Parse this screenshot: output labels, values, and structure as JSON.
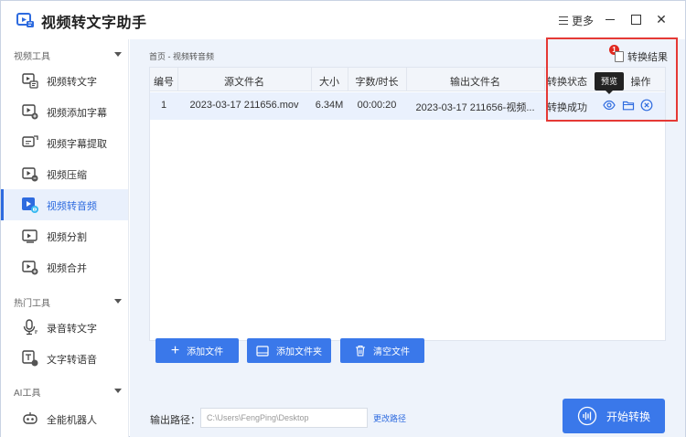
{
  "app": {
    "title": "视频转文字助手",
    "more_label": "更多",
    "brand_color": "#2e6bdf"
  },
  "window_controls": {
    "minimize_icon": "minimize-icon",
    "maximize_icon": "maximize-icon",
    "close_icon": "close-icon",
    "close_glyph": "✕"
  },
  "sidebar": {
    "sections": [
      {
        "label": "视频工具"
      },
      {
        "label": "热门工具"
      },
      {
        "label": "AI工具"
      }
    ],
    "items": [
      {
        "label": "视频转文字",
        "icon": "video-to-text-icon"
      },
      {
        "label": "视频添加字幕",
        "icon": "add-subtitle-icon"
      },
      {
        "label": "视频字幕提取",
        "icon": "extract-subtitle-icon"
      },
      {
        "label": "视频压缩",
        "icon": "compress-icon"
      },
      {
        "label": "视频转音频",
        "icon": "video-to-audio-icon",
        "active": true
      },
      {
        "label": "视频分割",
        "icon": "split-icon"
      },
      {
        "label": "视频合并",
        "icon": "merge-icon"
      },
      {
        "label": "录音转文字",
        "icon": "microphone-icon"
      },
      {
        "label": "文字转语音",
        "icon": "text-to-speech-icon"
      },
      {
        "label": "全能机器人",
        "icon": "robot-icon"
      }
    ]
  },
  "main": {
    "breadcrumb": "首页 - 视频转音频",
    "result_label": "转换结果",
    "result_badge": "1",
    "tooltip": "预览",
    "table": {
      "headers": [
        "编号",
        "源文件名",
        "大小",
        "字数/时长",
        "输出文件名",
        "转换状态",
        "操作"
      ],
      "rows": [
        {
          "index": "1",
          "source": "2023-03-17 211656.mov",
          "size": "6.34M",
          "duration": "00:00:20",
          "output": "2023-03-17 211656-视频...",
          "status": "转换成功"
        }
      ]
    },
    "buttons": {
      "add_file": "添加文件",
      "add_folder": "添加文件夹",
      "clear_files": "清空文件"
    },
    "output": {
      "label": "输出路径：",
      "path": "C:\\Users\\FengPing\\Desktop",
      "change": "更改路径"
    },
    "start_label": "开始转换"
  }
}
